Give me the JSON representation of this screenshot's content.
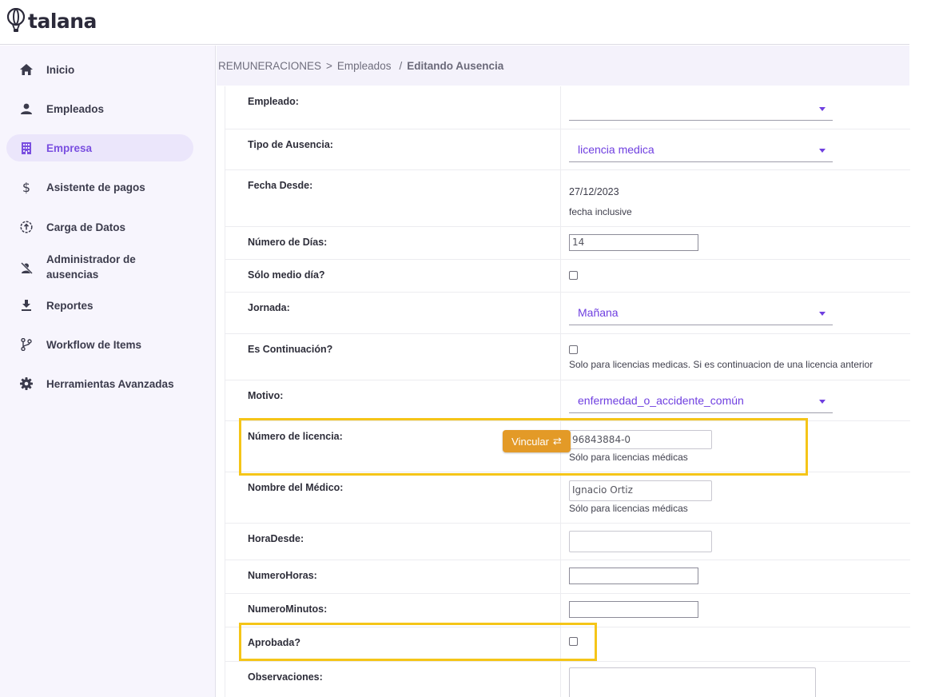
{
  "app": {
    "brand": "talana",
    "accent": "#7a4fe0",
    "highlight": "#f5c518"
  },
  "sidebar": {
    "items": [
      {
        "label": "Inicio",
        "icon": "home-icon",
        "active": false
      },
      {
        "label": "Empleados",
        "icon": "person-icon",
        "active": false
      },
      {
        "label": "Empresa",
        "icon": "building-icon",
        "active": true
      },
      {
        "label": "Asistente de pagos",
        "icon": "dollar-icon",
        "active": false
      },
      {
        "label": "Carga de Datos",
        "icon": "upload-circle-icon",
        "active": false
      },
      {
        "label": "Administrador de ausencias",
        "label_line1": "Administrador de",
        "label_line2": "ausencias",
        "icon": "person-off-icon",
        "active": false
      },
      {
        "label": "Reportes",
        "icon": "download-icon",
        "active": false
      },
      {
        "label": "Workflow de Items",
        "icon": "branch-icon",
        "active": false
      },
      {
        "label": "Herramientas Avanzadas",
        "icon": "gear-icon",
        "active": false
      }
    ]
  },
  "breadcrumb": {
    "root": "REMUNERACIONES",
    "sep1": ">",
    "section": "Empleados",
    "sep2": "/",
    "current": "Editando Ausencia"
  },
  "form": {
    "empleado": {
      "label": "Empleado:",
      "value": ""
    },
    "tipo_ausencia": {
      "label": "Tipo de Ausencia:",
      "value": "licencia medica"
    },
    "fecha_desde": {
      "label": "Fecha Desde:",
      "value": "27/12/2023",
      "help": "fecha inclusive"
    },
    "numero_dias": {
      "label": "Número de Días:",
      "value": "14"
    },
    "solo_medio_dia": {
      "label": "Sólo medio día?",
      "checked": false
    },
    "jornada": {
      "label": "Jornada:",
      "value": "Mañana"
    },
    "es_continuacion": {
      "label": "Es Continuación?",
      "checked": false,
      "help": "Solo para licencias medicas. Si es continuacion de una licencia anterior"
    },
    "motivo": {
      "label": "Motivo:",
      "value": "enfermedad_o_accidente_común"
    },
    "numero_licencia": {
      "label": "Número de licencia:",
      "value": "96843884-0",
      "help": "Sólo para licencias médicas",
      "button": "Vincular",
      "button_icon": "⇄"
    },
    "nombre_medico": {
      "label": "Nombre del Médico:",
      "value": "Ignacio Ortiz",
      "help": "Sólo para licencias médicas"
    },
    "hora_desde": {
      "label": "HoraDesde:",
      "value": ""
    },
    "numero_horas": {
      "label": "NumeroHoras:",
      "value": ""
    },
    "numero_minutos": {
      "label": "NumeroMinutos:",
      "value": ""
    },
    "aprobada": {
      "label": "Aprobada?",
      "checked": false
    },
    "observaciones": {
      "label": "Observaciones:",
      "value": ""
    }
  }
}
